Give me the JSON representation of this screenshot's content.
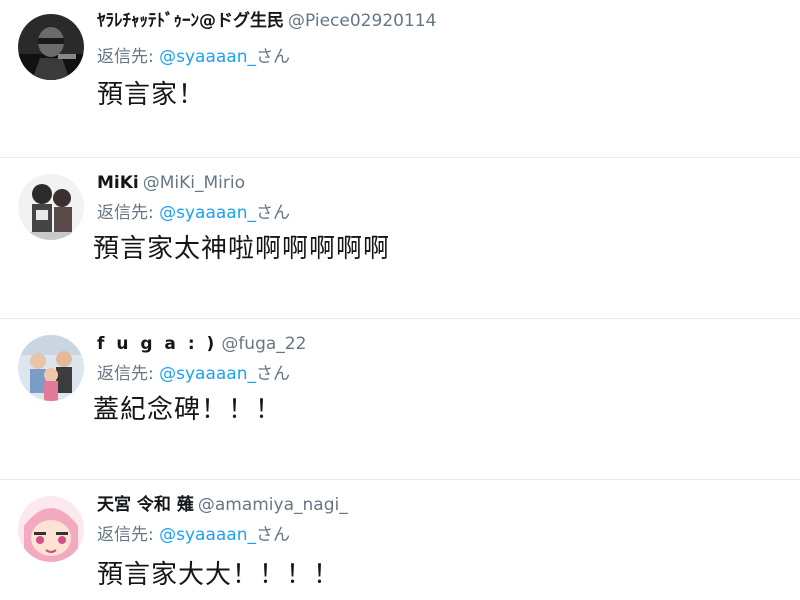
{
  "reply_label": "返信先:",
  "colors": {
    "link": "#1da1f2",
    "muted": "#657786",
    "text": "#14171a",
    "divider": "#e6ecf0"
  },
  "tweets": [
    {
      "name": "ﾔﾗﾚﾁｬｯﾃﾄﾞｩｰﾝ@ドグ生民",
      "handle": "@Piece02920114",
      "reply_to": "@syaaaan_",
      "reply_suffix": "さん",
      "text": "預言家！",
      "avatar": "dark-character-avatar"
    },
    {
      "name": "MiKi",
      "handle": "@MiKi_Mirio",
      "reply_to": "@syaaaan_",
      "reply_suffix": "さん",
      "text": "預言家太神啦啊啊啊啊啊",
      "avatar": "anime-characters-avatar"
    },
    {
      "name": "f u g a : )",
      "handle": "@fuga_22",
      "reply_to": "@syaaaan_",
      "reply_suffix": "さん",
      "text": "蓋紀念碑！！！",
      "avatar": "group-photo-avatar"
    },
    {
      "name": "天宮 令和 薙",
      "handle": "@amamiya_nagi_",
      "reply_to": "@syaaaan_",
      "reply_suffix": "さん",
      "text": "預言家大大！！！！",
      "avatar": "pink-hair-anime-avatar"
    }
  ]
}
